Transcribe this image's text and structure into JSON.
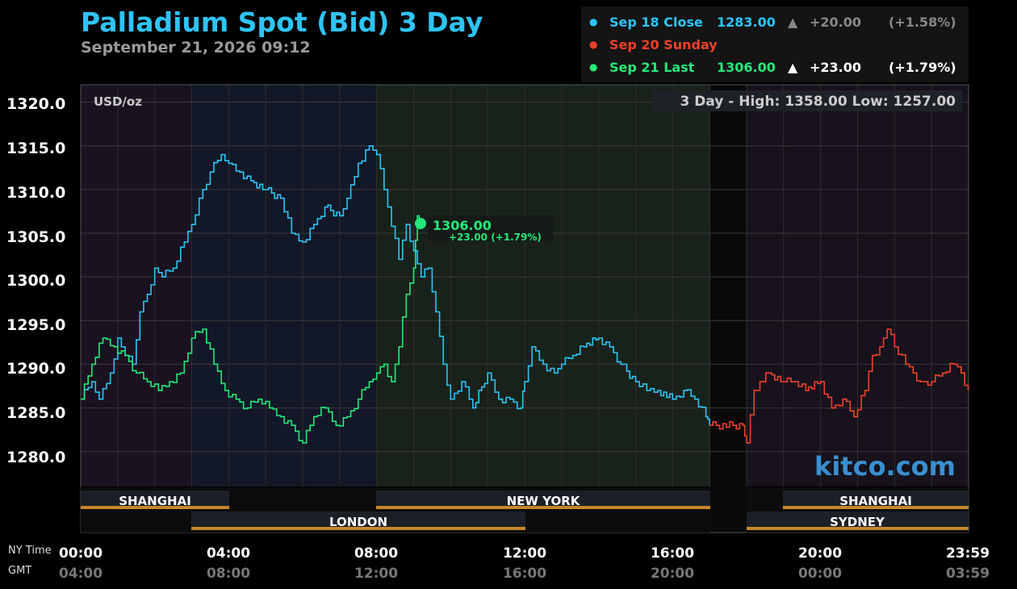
{
  "header": {
    "title": "Palladium Spot (Bid) 3 Day",
    "subtitle": "September 21, 2026 09:12"
  },
  "legend": [
    {
      "label": "Sep 18 Close",
      "value": "1283.00",
      "arrow": "▲",
      "change": "+20.00",
      "pct": "(+1.58%)",
      "color": "#2ec4f5"
    },
    {
      "label": "Sep 20 Sunday",
      "value": "",
      "arrow": "",
      "change": "",
      "pct": "",
      "color": "#f0402a"
    },
    {
      "label": "Sep 21 Last",
      "value": "1306.00",
      "arrow": "▲",
      "change": "+23.00",
      "pct": "(+1.79%)",
      "color": "#27e87a"
    }
  ],
  "chart": {
    "unit_label": "USD/oz",
    "high_low": "3 Day - High: 1358.00  Low: 1257.00",
    "watermark": "kitco.com",
    "last_callout": {
      "value": "1306.00",
      "change": "+23.00 (+1.79%)"
    },
    "x_axis_names": {
      "ny": "NY Time",
      "gmt": "GMT"
    },
    "x_ticks_ny": [
      "00:00",
      "04:00",
      "08:00",
      "12:00",
      "16:00",
      "20:00",
      "23:59"
    ],
    "x_ticks_gmt": [
      "04:00",
      "08:00",
      "12:00",
      "16:00",
      "20:00",
      "00:00",
      "03:59"
    ],
    "sessions": [
      "SHANGHAI",
      "NEW YORK",
      "SHANGHAI",
      "LONDON",
      "SYDNEY"
    ],
    "colors": {
      "sep18": "#2ec4f5",
      "sunday": "#f0402a",
      "sep21": "#27e87a",
      "session_bar": "#c8862a"
    }
  },
  "chart_data": {
    "type": "line",
    "title": "Palladium Spot (Bid) 3 Day",
    "ylabel": "USD/oz",
    "ylim": [
      1276,
      1322
    ],
    "xlim_hours": [
      0,
      24
    ],
    "y_ticks": [
      "1320.0",
      "1315.0",
      "1310.0",
      "1305.0",
      "1300.0",
      "1295.0",
      "1290.0",
      "1285.0",
      "1280.0"
    ],
    "y_tick_values": [
      1320,
      1315,
      1310,
      1305,
      1300,
      1295,
      1290,
      1285,
      1280
    ],
    "series": [
      {
        "name": "Sep 18 Close",
        "color": "#2ec4f5",
        "x": [
          0,
          0.3,
          0.5,
          0.8,
          1.0,
          1.2,
          1.4,
          1.6,
          1.8,
          2.0,
          2.2,
          2.5,
          2.8,
          3.0,
          3.2,
          3.5,
          3.8,
          4.0,
          4.3,
          4.6,
          5.0,
          5.4,
          5.7,
          6.0,
          6.3,
          6.6,
          7.0,
          7.2,
          7.5,
          7.8,
          8.0,
          8.3,
          8.6,
          8.8,
          9.0,
          9.2,
          9.4,
          9.6,
          9.8,
          10.0,
          10.3,
          10.6,
          11.0,
          11.3,
          11.6,
          11.9,
          12.0,
          12.2,
          12.5,
          12.8,
          13.0,
          13.3,
          13.6,
          14.0,
          14.3,
          14.6,
          15.0,
          15.3,
          15.6,
          16.0,
          16.3,
          16.6,
          16.9,
          17.0
        ],
        "y": [
          1286,
          1288,
          1286,
          1289,
          1293,
          1291,
          1290,
          1296,
          1298,
          1301,
          1300,
          1301,
          1304,
          1306,
          1309,
          1312,
          1314,
          1313,
          1312,
          1311,
          1310,
          1309,
          1305,
          1304,
          1306,
          1308,
          1307,
          1309,
          1313,
          1315,
          1314,
          1308,
          1302,
          1306,
          1303,
          1300,
          1301,
          1296,
          1290,
          1286,
          1288,
          1285,
          1289,
          1286,
          1286,
          1285,
          1288,
          1292,
          1290,
          1289,
          1290,
          1291,
          1292,
          1293,
          1292,
          1290,
          1288,
          1287,
          1287,
          1286,
          1287,
          1286,
          1284,
          1283
        ]
      },
      {
        "name": "Sep 20 Sunday",
        "color": "#f0402a",
        "x": [
          17,
          17.9,
          18.0,
          18.2,
          18.6,
          19.0,
          19.3,
          19.6,
          20.0,
          20.3,
          20.6,
          20.9,
          21.2,
          21.4,
          21.6,
          21.8,
          22.0,
          22.3,
          22.5,
          22.7,
          23.0,
          23.3,
          23.6,
          23.8,
          23.99
        ],
        "y": [
          1283,
          1283,
          1281,
          1287,
          1289,
          1288,
          1288,
          1287,
          1288,
          1285,
          1286,
          1284,
          1287,
          1291,
          1292,
          1294,
          1292,
          1290,
          1289,
          1288,
          1288,
          1289,
          1290,
          1289,
          1287
        ]
      },
      {
        "name": "Sep 21 Last",
        "color": "#27e87a",
        "x": [
          0,
          0.3,
          0.6,
          0.9,
          1.2,
          1.5,
          1.8,
          2.1,
          2.4,
          2.7,
          3.0,
          3.3,
          3.6,
          3.9,
          4.2,
          4.5,
          4.8,
          5.1,
          5.4,
          5.7,
          6.0,
          6.3,
          6.6,
          6.9,
          7.2,
          7.5,
          7.8,
          8.0,
          8.2,
          8.4,
          8.6,
          8.8,
          9.0,
          9.1,
          9.2
        ],
        "y": [
          1286,
          1290,
          1293,
          1292,
          1291,
          1289,
          1288,
          1287,
          1288,
          1289,
          1293,
          1294,
          1290,
          1287,
          1286,
          1285,
          1286,
          1285,
          1284,
          1283,
          1281,
          1284,
          1285,
          1283,
          1284,
          1286,
          1288,
          1289,
          1290,
          1288,
          1292,
          1298,
          1301,
          1307,
          1306
        ]
      }
    ]
  }
}
